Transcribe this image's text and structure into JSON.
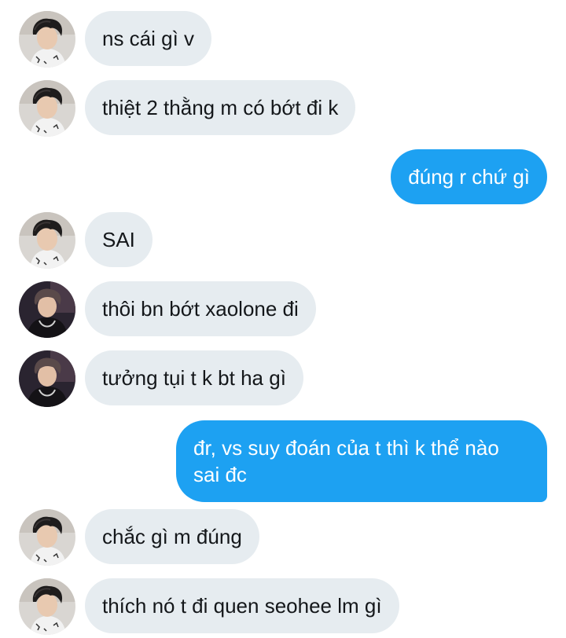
{
  "conversation": {
    "accent_color": "#1da1f2",
    "incoming_bubble_color": "#e6ecf0",
    "messages": [
      {
        "sender": "contact-a",
        "text": "ns cái gì v"
      },
      {
        "sender": "contact-a",
        "text": "thiệt 2 thằng m có bớt đi k"
      },
      {
        "sender": "me",
        "text": "đúng r chứ gì"
      },
      {
        "sender": "contact-a",
        "text": "SAI"
      },
      {
        "sender": "contact-b",
        "text": "thôi bn bớt xaolone đi"
      },
      {
        "sender": "contact-b",
        "text": "tưởng tụi t k bt ha gì"
      },
      {
        "sender": "me",
        "text": "đr, vs suy đoán của t thì k thể nào sai đc"
      },
      {
        "sender": "contact-a",
        "text": "chắc gì m đúng"
      },
      {
        "sender": "contact-a",
        "text": "thích nó t đi quen seohee lm gì"
      }
    ]
  }
}
